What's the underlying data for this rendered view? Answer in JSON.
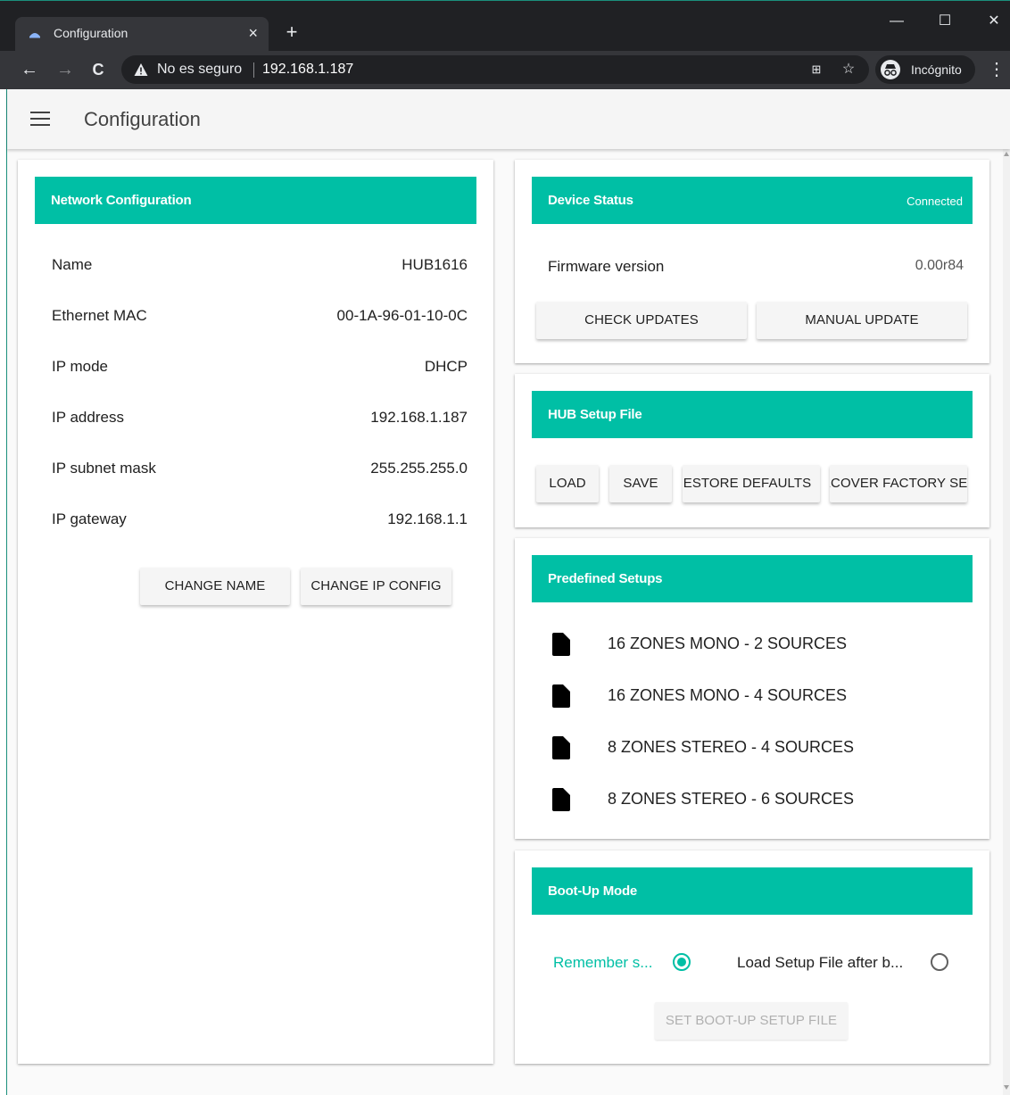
{
  "browser": {
    "tab_title": "Configuration",
    "tab_close": "×",
    "new_tab": "+",
    "security_label": "No es seguro",
    "url": "192.168.1.187",
    "profile_label": "Incógnito",
    "window_controls": {
      "minimize": "—",
      "maximize": "☐",
      "close": "✕"
    },
    "nav": {
      "back": "←",
      "forward": "→",
      "reload": "C"
    }
  },
  "appbar": {
    "title": "Configuration"
  },
  "network": {
    "header": "Network Configuration",
    "rows": [
      {
        "label": "Name",
        "value": "HUB1616"
      },
      {
        "label": "Ethernet MAC",
        "value": "00-1A-96-01-10-0C"
      },
      {
        "label": "IP mode",
        "value": "DHCP"
      },
      {
        "label": "IP address",
        "value": "192.168.1.187"
      },
      {
        "label": "IP subnet mask",
        "value": "255.255.255.0"
      },
      {
        "label": "IP gateway",
        "value": "192.168.1.1"
      }
    ],
    "buttons": {
      "change_name": "CHANGE NAME",
      "change_ip": "CHANGE IP CONFIG"
    }
  },
  "device_status": {
    "header": "Device Status",
    "status": "Connected",
    "firmware_label": "Firmware version",
    "firmware_value": "0.00r84",
    "buttons": {
      "check_updates": "CHECK UPDATES",
      "manual_update": "MANUAL UPDATE"
    }
  },
  "setup_file": {
    "header": "HUB Setup File",
    "buttons": {
      "load": "LOAD",
      "save": "SAVE",
      "restore_defaults": "RESTORE DEFAULTS",
      "recover_factory": "RECOVER FACTORY SET"
    }
  },
  "predefined": {
    "header": "Predefined Setups",
    "items": [
      "16 ZONES MONO - 2 SOURCES",
      "16 ZONES MONO - 4 SOURCES",
      "8 ZONES STEREO - 4 SOURCES",
      "8 ZONES STEREO - 6 SOURCES"
    ]
  },
  "bootup": {
    "header": "Boot-Up Mode",
    "option_remember": "Remember s...",
    "option_load": "Load Setup File after b...",
    "selected": "remember",
    "button": "SET BOOT-UP SETUP FILE"
  },
  "colors": {
    "accent": "#00bfa5",
    "chrome_dark": "#202124",
    "chrome_toolbar": "#35363a"
  }
}
